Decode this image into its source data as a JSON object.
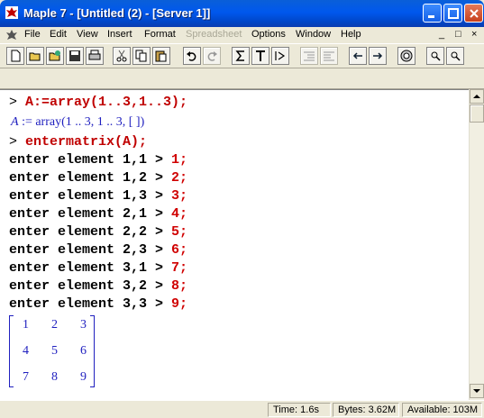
{
  "window": {
    "title": "Maple 7  - [Untitled (2) - [Server 1]]"
  },
  "menu": {
    "items": [
      {
        "label": "File"
      },
      {
        "label": "Edit"
      },
      {
        "label": "View"
      },
      {
        "label": "Insert"
      },
      {
        "label": "Format"
      },
      {
        "label": "Spreadsheet",
        "disabled": true
      },
      {
        "label": "Options"
      },
      {
        "label": "Window"
      },
      {
        "label": "Help"
      }
    ],
    "mdi_controls": [
      "_",
      "□",
      "×"
    ]
  },
  "toolbar": {
    "buttons": [
      "new-icon",
      "open-icon",
      "open-url-icon",
      "save-icon",
      "print-icon",
      "cut-icon",
      "copy-icon",
      "paste-icon",
      "undo-icon",
      "redo-icon",
      "sigma-icon",
      "text-icon",
      "execution-group-icon",
      "indent-icon",
      "outdent-icon",
      "back-icon",
      "forward-icon",
      "stop-icon",
      "zoom-in-icon",
      "zoom-out-icon"
    ]
  },
  "worksheet": {
    "prompt": ">",
    "input1": "A:=array(1..3,1..3);",
    "output1_lhs": "A",
    "output1_rhs": ":= array(1 .. 3, 1 .. 3, [ ])",
    "input2": "entermatrix(A);",
    "entries": [
      {
        "label": "enter element 1,1 >",
        "value": "1;"
      },
      {
        "label": "enter element 1,2 >",
        "value": "2;"
      },
      {
        "label": "enter element 1,3 >",
        "value": "3;"
      },
      {
        "label": "enter element 2,1 >",
        "value": "4;"
      },
      {
        "label": "enter element 2,2 >",
        "value": "5;"
      },
      {
        "label": "enter element 2,3 >",
        "value": "6;"
      },
      {
        "label": "enter element 3,1 >",
        "value": "7;"
      },
      {
        "label": "enter element 3,2 >",
        "value": "8;"
      },
      {
        "label": "enter element 3,3 >",
        "value": "9;"
      }
    ],
    "matrix": [
      [
        "1",
        "2",
        "3"
      ],
      [
        "4",
        "5",
        "6"
      ],
      [
        "7",
        "8",
        "9"
      ]
    ]
  },
  "status": {
    "time": "Time:   1.6s",
    "bytes": "Bytes: 3.62M",
    "available": "Available: 103M"
  },
  "colors": {
    "command": "#c00000",
    "output": "#1f1fbf",
    "titlebar": "#0058ee"
  }
}
